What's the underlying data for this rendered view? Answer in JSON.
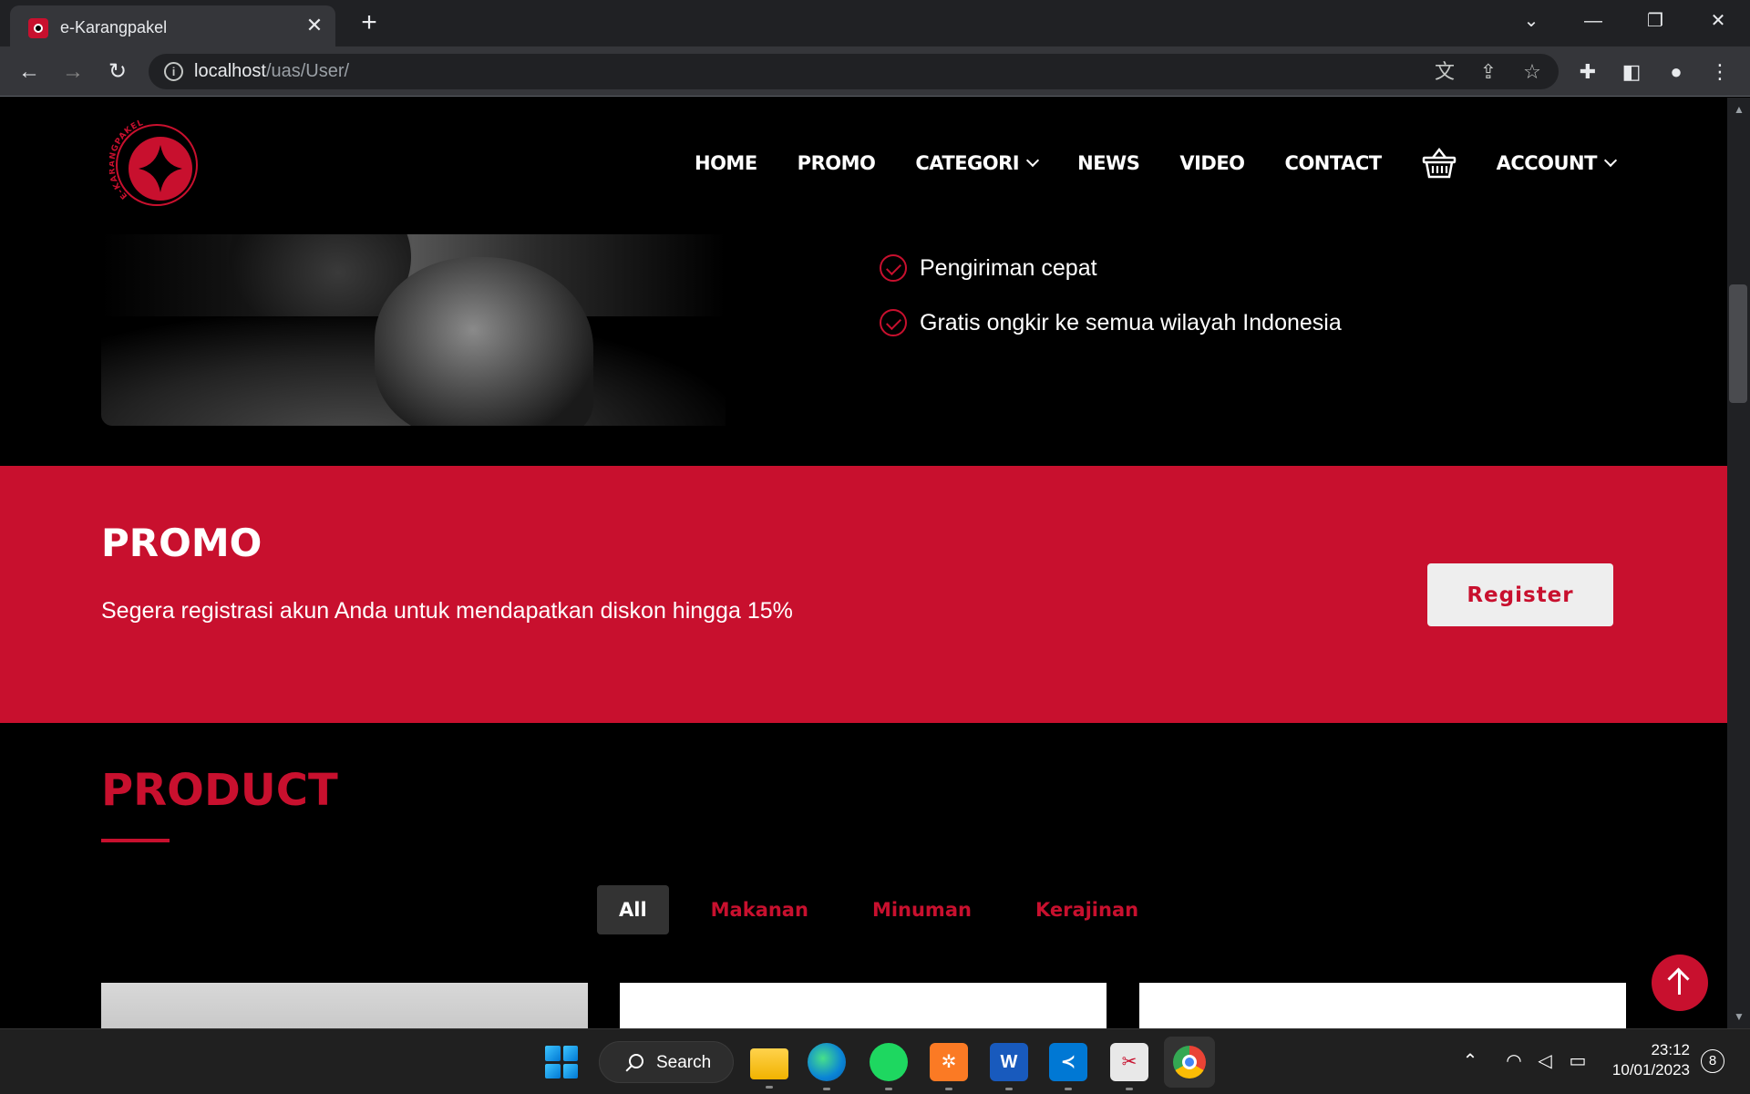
{
  "browser": {
    "tab_title": "e-Karangpakel",
    "url_host": "localhost",
    "url_path": "/uas/User/"
  },
  "site": {
    "logo_text": "E-KARANGPAKEL",
    "nav": [
      "HOME",
      "PROMO",
      "CATEGORI",
      "NEWS",
      "VIDEO",
      "CONTACT",
      "ACCOUNT"
    ],
    "brand_color": "#c8102e"
  },
  "features": [
    "Pengiriman cepat",
    "Gratis ongkir ke semua wilayah Indonesia"
  ],
  "promo": {
    "title": "PROMO",
    "text": "Segera registrasi akun Anda untuk mendapatkan diskon hingga 15%",
    "button": "Register"
  },
  "product": {
    "title": "PRODUCT",
    "filters": [
      "All",
      "Makanan",
      "Minuman",
      "Kerajinan"
    ],
    "active_filter": "All"
  },
  "taskbar": {
    "search_label": "Search",
    "time": "23:12",
    "date": "10/01/2023",
    "notifications": "8",
    "apps": [
      "file-explorer",
      "edge",
      "spotify",
      "xampp",
      "word",
      "vscode",
      "snipping-tool",
      "chrome"
    ]
  }
}
